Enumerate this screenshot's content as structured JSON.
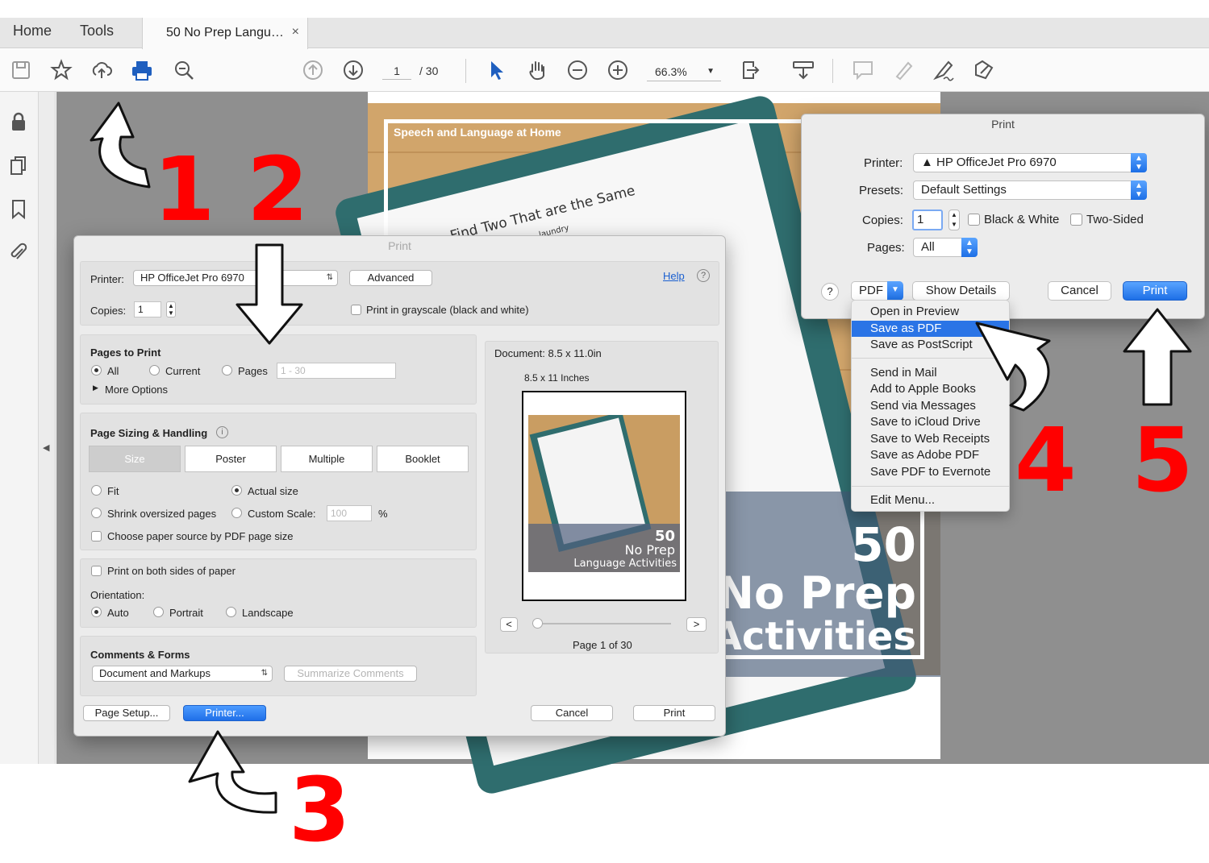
{
  "menu_tabs": {
    "home": "Home",
    "tools": "Tools"
  },
  "doc_tab": {
    "title": "50 No Prep Langu…",
    "close": "×"
  },
  "toolbar": {
    "icons": [
      "save-icon",
      "bookmark-star-icon",
      "upload-cloud-icon",
      "print-icon",
      "zoom-search-icon",
      "page-up-icon",
      "page-down-icon",
      "select-arrow-icon",
      "hand-icon",
      "zoom-out-icon",
      "zoom-in-icon",
      "fit-page-icon",
      "scroll-mode-icon",
      "comment-icon",
      "highlight-icon",
      "sign-icon",
      "edit-icon"
    ],
    "page_current": "1",
    "page_total": "/ 30",
    "zoom": "66.3%"
  },
  "sidebar": {
    "icons": [
      "lock-icon",
      "pages-icon",
      "bookmark-icon",
      "attachment-icon"
    ]
  },
  "pdf": {
    "header": "Speech and Language at Home",
    "worksheet_title": "Find Two That are the Same",
    "worksheet_sub": "laundry",
    "cover_line1": "50",
    "cover_line2": "No Prep",
    "cover_line3": "Activities"
  },
  "adobe_print": {
    "title": "Print",
    "printer_label": "Printer:",
    "printer_value": "HP OfficeJet Pro 6970",
    "advanced": "Advanced",
    "help": "Help",
    "copies_label": "Copies:",
    "copies_value": "1",
    "grayscale": "Print in grayscale (black and white)",
    "pages_to_print": {
      "title": "Pages to Print",
      "all": "All",
      "current": "Current",
      "pages": "Pages",
      "range_placeholder": "1 - 30",
      "more_options": "More Options"
    },
    "sizing": {
      "title": "Page Sizing & Handling",
      "tabs": [
        "Size",
        "Poster",
        "Multiple",
        "Booklet"
      ],
      "fit": "Fit",
      "actual_size": "Actual size",
      "shrink": "Shrink oversized pages",
      "custom_scale": "Custom Scale:",
      "scale_value": "100",
      "percent": "%",
      "paper_source": "Choose paper source by PDF page size"
    },
    "duplex": "Print on both sides of paper",
    "orientation": {
      "label": "Orientation:",
      "auto": "Auto",
      "portrait": "Portrait",
      "landscape": "Landscape"
    },
    "comments": {
      "title": "Comments & Forms",
      "value": "Document and Markups",
      "summarize": "Summarize Comments"
    },
    "preview": {
      "document": "Document: 8.5 x 11.0in",
      "paper": "8.5 x 11 Inches",
      "thumb_50": "50",
      "thumb_noprep": "No Prep",
      "thumb_lang": "Language Activities",
      "prev": "<",
      "next": ">",
      "page_info": "Page 1 of 30"
    },
    "page_setup": "Page Setup...",
    "printer_btn": "Printer...",
    "cancel": "Cancel",
    "print": "Print"
  },
  "mac_print": {
    "title": "Print",
    "printer_label": "Printer:",
    "printer_value": "▲ HP OfficeJet Pro 6970",
    "presets_label": "Presets:",
    "presets_value": "Default Settings",
    "copies_label": "Copies:",
    "copies_value": "1",
    "bw": "Black & White",
    "two_sided": "Two-Sided",
    "pages_label": "Pages:",
    "pages_value": "All",
    "help": "?",
    "pdf": "PDF",
    "show_details": "Show Details",
    "cancel": "Cancel",
    "print": "Print"
  },
  "pdf_menu": {
    "items": [
      "Open in Preview",
      "Save as PDF",
      "Save as PostScript",
      "Send in Mail",
      "Add to Apple Books",
      "Send via Messages",
      "Save to iCloud Drive",
      "Save to Web Receipts",
      "Save as Adobe PDF",
      "Save PDF to Evernote",
      "Edit Menu..."
    ],
    "highlighted": "Save as PDF"
  },
  "steps": [
    "1",
    "2",
    "3",
    "4",
    "5"
  ],
  "colors": {
    "accent_blue": "#2a74e6",
    "annotation_red": "#ff0000",
    "canvas_gray": "#8f8f8f"
  }
}
